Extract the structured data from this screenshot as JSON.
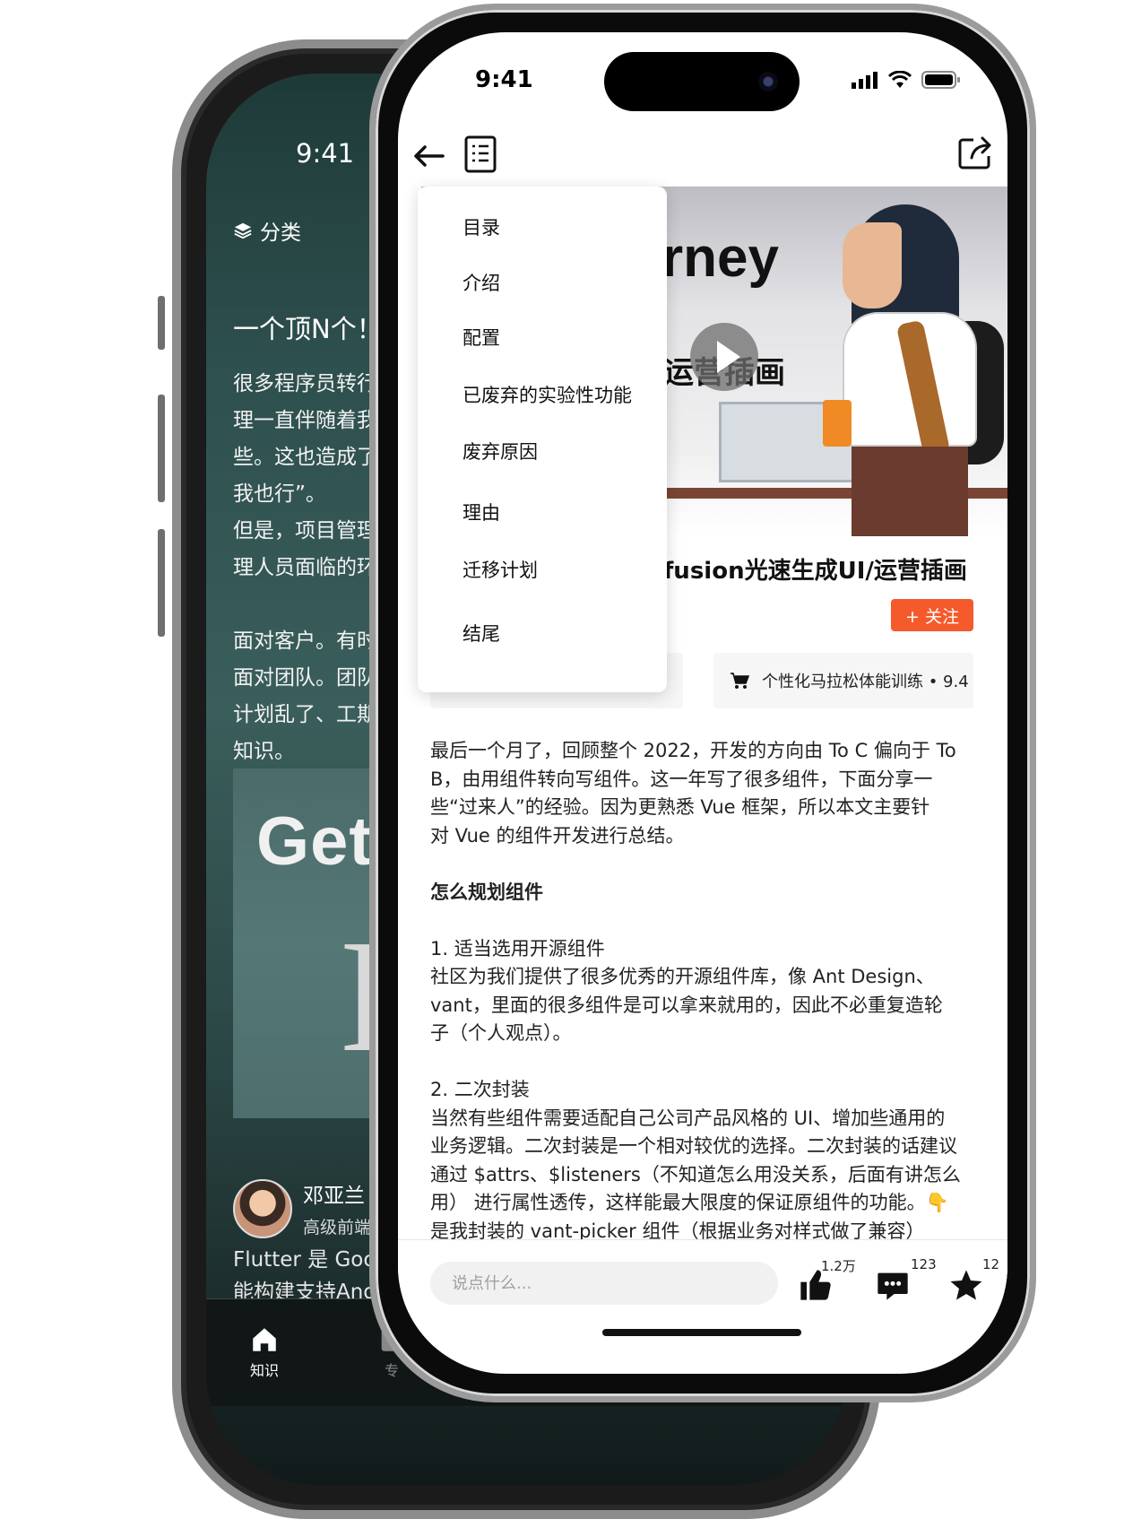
{
  "back_phone": {
    "time": "9:41",
    "category_label": "分类",
    "article_title": "一个顶N个！F",
    "body_lines": [
      "很多程序员转行做",
      "理一直伴随着我们",
      "些。这也造成了一",
      "我也行”。",
      "但是，项目管理从",
      "理人员面临的环境",
      "",
      "面对客户。有时候",
      "面对团队。团队也",
      "计划乱了、工期排",
      "知识。"
    ],
    "image_text_1": "GetV",
    "image_text_2": "I",
    "author_name": "邓亚兰",
    "author_role": "高级前端工程",
    "desc_line_1": "Flutter 是 Google",
    "desc_line_2": "能构建支持Androi",
    "tabs": [
      {
        "label": "知识",
        "icon": "home-icon"
      },
      {
        "label": "专",
        "icon": "column-icon"
      }
    ]
  },
  "front_phone": {
    "time": "9:41",
    "toc_menu": {
      "items": [
        "目录",
        "介绍",
        "配置",
        "已废弃的实验性功能",
        "废弃原因",
        "理由",
        "迁移计划",
        "结尾"
      ]
    },
    "hero": {
      "word": "rney",
      "subtitle": "运营插画"
    },
    "article_title": "fusion光速生成UI/运营插画",
    "follow_label": "+ 关注",
    "course_card": {
      "icon": "cart-icon",
      "text": "个性化马拉松体能训练  •  9.4"
    },
    "article_lines": [
      {
        "text": "最后一个月了，回顾整个 2022，开发的方向由 To C 偏向于 To",
        "bold": false
      },
      {
        "text": "B，由用组件转向写组件。这一年写了很多组件，下面分享一",
        "bold": false
      },
      {
        "text": "些“过来人”的经验。因为更熟悉 Vue 框架，所以本文主要针",
        "bold": false
      },
      {
        "text": "对 Vue 的组件开发进行总结。",
        "bold": false
      },
      {
        "text": "",
        "bold": false
      },
      {
        "text": "怎么规划组件",
        "bold": true
      },
      {
        "text": "",
        "bold": false
      },
      {
        "text": "1. 适当选用开源组件",
        "bold": false
      },
      {
        "text": "社区为我们提供了很多优秀的开源组件库，像 Ant Design、",
        "bold": false
      },
      {
        "text": "vant，里面的很多组件是可以拿来就用的，因此不必重复造轮",
        "bold": false
      },
      {
        "text": "子（个人观点）。",
        "bold": false
      },
      {
        "text": "",
        "bold": false
      },
      {
        "text": "2. 二次封装",
        "bold": false
      },
      {
        "text": "当然有些组件需要适配自己公司产品风格的 UI、增加些通用的",
        "bold": false
      },
      {
        "text": "业务逻辑。二次封装是一个相对较优的选择。二次封装的话建议",
        "bold": false
      },
      {
        "text": "通过 $attrs、$listeners（不知道怎么用没关系，后面有讲怎么",
        "bold": false
      },
      {
        "text": "用） 进行属性透传，这样能最大限度的保证原组件的功能。👇",
        "bold": false
      },
      {
        "text": "是我封装的 vant-picker 组件（根据业务对样式做了兼容）",
        "bold": false
      }
    ],
    "comment_placeholder": "说点什么...",
    "actions": {
      "like_count": "1.2万",
      "comment_count": "123",
      "favorite_count": "12"
    }
  }
}
